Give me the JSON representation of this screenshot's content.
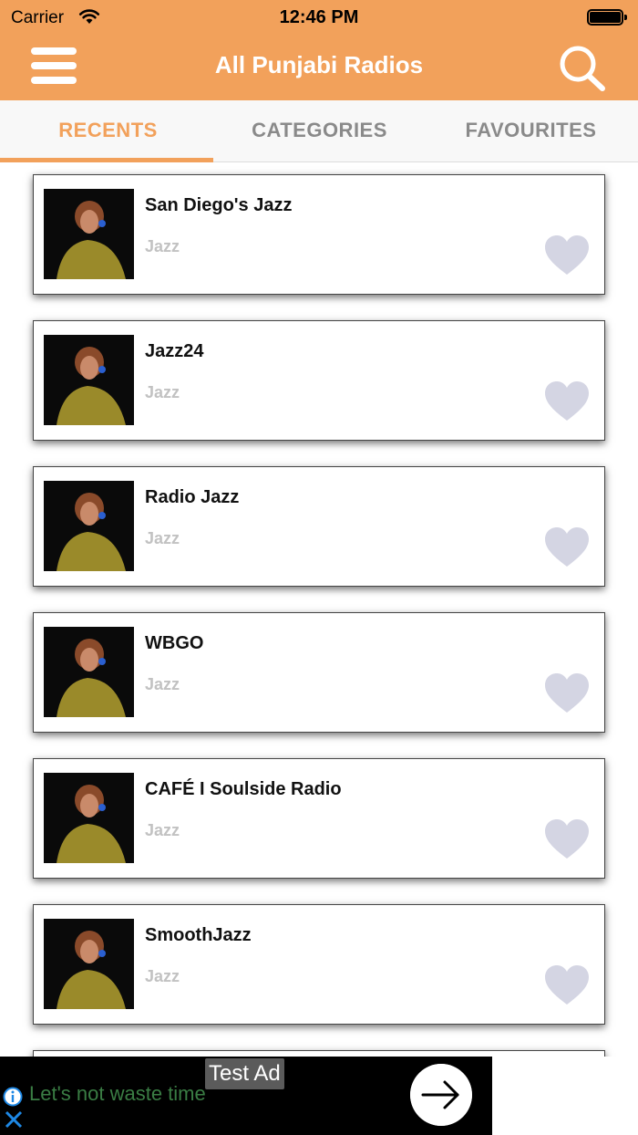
{
  "status": {
    "carrier": "Carrier",
    "time": "12:46 PM"
  },
  "nav": {
    "title": "All Punjabi Radios",
    "menu_icon": "hamburger-menu-icon",
    "search_icon": "search-icon"
  },
  "tabs": [
    {
      "label": "RECENTS",
      "active": true
    },
    {
      "label": "CATEGORIES",
      "active": false
    },
    {
      "label": "FAVOURITES",
      "active": false
    }
  ],
  "stations": [
    {
      "name": "San Diego's Jazz",
      "category": "Jazz"
    },
    {
      "name": "Jazz24",
      "category": "Jazz"
    },
    {
      "name": "Radio Jazz",
      "category": "Jazz"
    },
    {
      "name": "WBGO",
      "category": "Jazz"
    },
    {
      "name": "CAFÉ I Soulside Radio",
      "category": "Jazz"
    },
    {
      "name": "SmoothJazz",
      "category": "Jazz"
    }
  ],
  "ad": {
    "label": "Test Ad",
    "text": "Let's not waste time",
    "cta_icon": "arrow-right-icon"
  },
  "colors": {
    "accent": "#f2a15b",
    "heart": "#d4d5e3",
    "subtitle": "#c2c2c2"
  }
}
